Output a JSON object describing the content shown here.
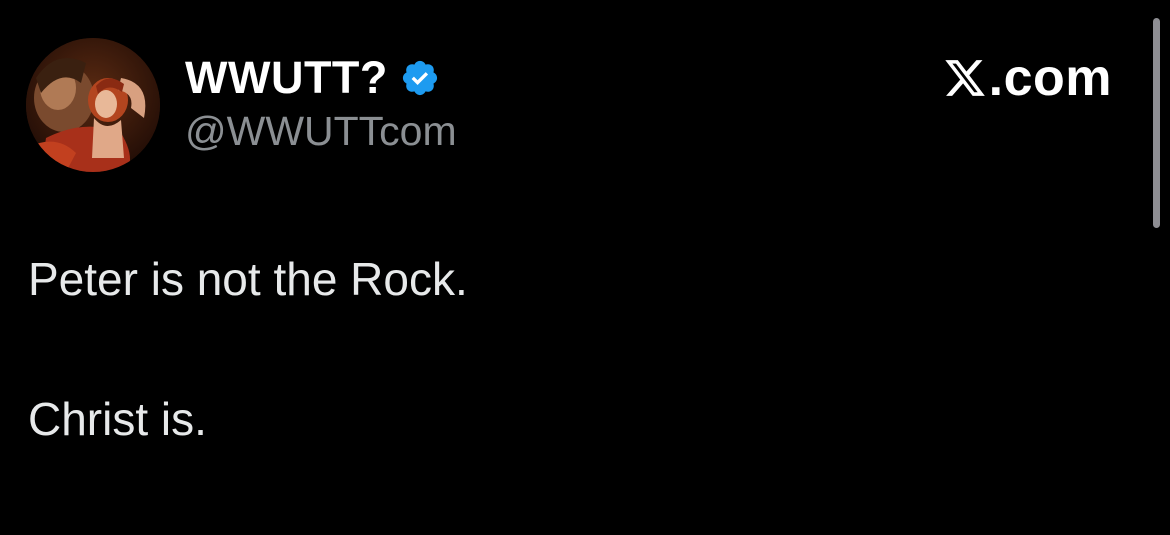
{
  "author": {
    "display_name": "WWUTT?",
    "handle": "@WWUTTcom",
    "verified_color": "#1d9bf0"
  },
  "brand": {
    "text": ".com",
    "icon": "x-logo-icon"
  },
  "tweet": {
    "lines": [
      "Peter is not the Rock.",
      "Christ is."
    ]
  },
  "colors": {
    "background": "#000000",
    "text": "#e7e9ea",
    "handle": "#8b8f93"
  }
}
